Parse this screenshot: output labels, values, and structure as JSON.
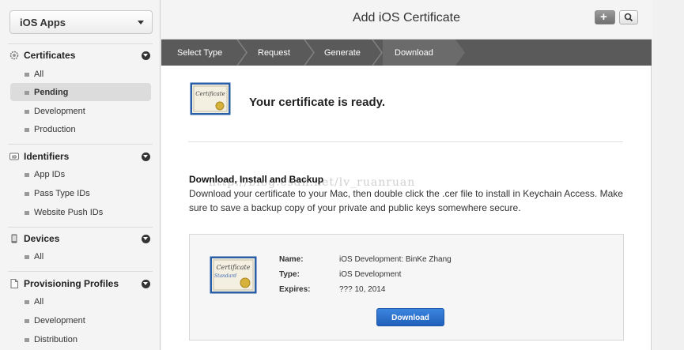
{
  "sidebar": {
    "app_select": "iOS Apps",
    "sections": [
      {
        "title": "Certificates",
        "icon": "certificate-icon",
        "items": [
          {
            "label": "All"
          },
          {
            "label": "Pending",
            "active": true
          },
          {
            "label": "Development"
          },
          {
            "label": "Production"
          }
        ]
      },
      {
        "title": "Identifiers",
        "icon": "id-badge-icon",
        "items": [
          {
            "label": "App IDs"
          },
          {
            "label": "Pass Type IDs"
          },
          {
            "label": "Website Push IDs"
          }
        ]
      },
      {
        "title": "Devices",
        "icon": "device-icon",
        "items": [
          {
            "label": "All"
          }
        ]
      },
      {
        "title": "Provisioning Profiles",
        "icon": "document-icon",
        "items": [
          {
            "label": "All"
          },
          {
            "label": "Development"
          },
          {
            "label": "Distribution"
          }
        ]
      }
    ]
  },
  "header": {
    "title": "Add iOS Certificate"
  },
  "steps": [
    "Select Type",
    "Request",
    "Generate",
    "Download"
  ],
  "ready": {
    "message": "Your certificate is ready.",
    "icon_text": "Certificate"
  },
  "download_section": {
    "title": "Download, Install and Backup",
    "description": "Download your certificate to your Mac, then double click the .cer file to install in Keychain Access. Make sure to save a backup copy of your private and public keys somewhere secure.",
    "watermark": "http://blog.csdn.net/lv_ruanruan"
  },
  "certificate": {
    "icon_title": "Certificate",
    "icon_subtitle": "Standard",
    "name_label": "Name:",
    "name": "iOS Development: BinKe Zhang",
    "type_label": "Type:",
    "type": "iOS Development",
    "expires_label": "Expires:",
    "expires": "??? 10, 2014",
    "button": "Download"
  },
  "colors": {
    "accent": "#2a6fcf",
    "stepbar": "#5a5a5a"
  }
}
